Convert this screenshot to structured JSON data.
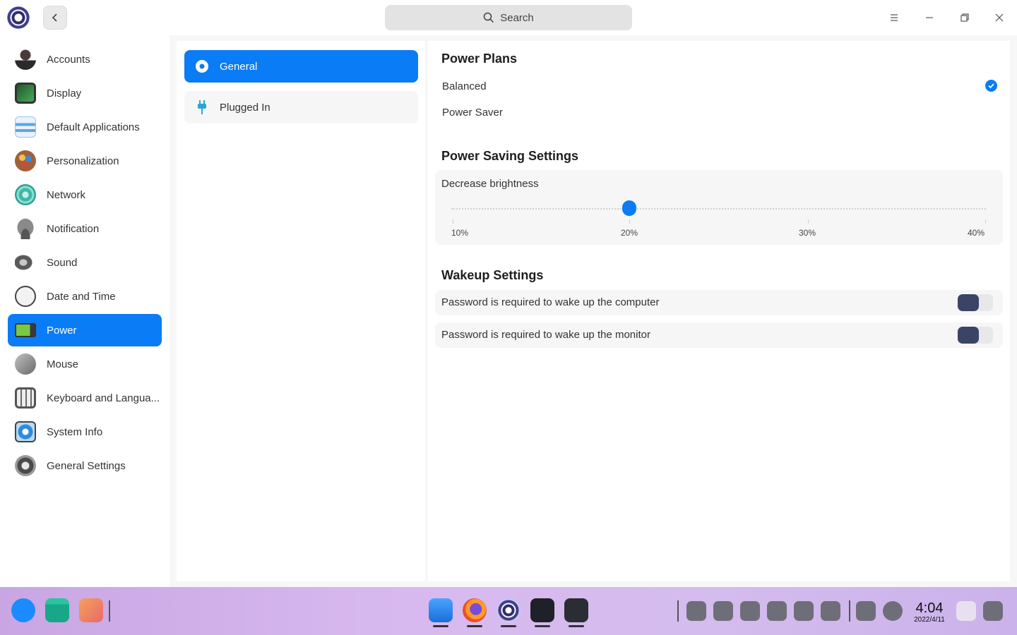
{
  "titlebar": {
    "search_placeholder": "Search"
  },
  "sidebar": {
    "items": [
      {
        "label": "Accounts",
        "icon": "accounts-icon",
        "color": "#2b2b2b"
      },
      {
        "label": "Display",
        "icon": "display-icon",
        "color": "#2f7a3f"
      },
      {
        "label": "Default Applications",
        "icon": "default-applications-icon",
        "color": "#5ea4e6"
      },
      {
        "label": "Personalization",
        "icon": "personalization-icon",
        "color": "#b0503a"
      },
      {
        "label": "Network",
        "icon": "network-icon",
        "color": "#3fb7a8"
      },
      {
        "label": "Notification",
        "icon": "notification-icon",
        "color": "#7d7d7d"
      },
      {
        "label": "Sound",
        "icon": "sound-icon",
        "color": "#5a5a5a"
      },
      {
        "label": "Date and Time",
        "icon": "clock-icon",
        "color": "#e8e8e8"
      },
      {
        "label": "Power",
        "icon": "battery-icon",
        "color": "#7ac943"
      },
      {
        "label": "Mouse",
        "icon": "mouse-icon",
        "color": "#8a8a8a"
      },
      {
        "label": "Keyboard and Langua...",
        "icon": "keyboard-icon",
        "color": "#6a6a6a"
      },
      {
        "label": "System Info",
        "icon": "system-info-icon",
        "color": "#2d8be0"
      },
      {
        "label": "General Settings",
        "icon": "general-settings-icon",
        "color": "#4a4a4a"
      }
    ],
    "active_index": 8
  },
  "middle": {
    "items": [
      {
        "label": "General",
        "icon": "gear-icon"
      },
      {
        "label": "Plugged In",
        "icon": "plug-icon"
      }
    ],
    "active_index": 0
  },
  "power_plans": {
    "title": "Power Plans",
    "options": [
      "Balanced",
      "Power Saver"
    ],
    "selected": "Balanced"
  },
  "power_saving": {
    "title": "Power Saving Settings",
    "brightness_label": "Decrease brightness",
    "ticks": [
      "10%",
      "20%",
      "30%",
      "40%"
    ],
    "value": "20%"
  },
  "wakeup": {
    "title": "Wakeup Settings",
    "computer_label": "Password is required to wake up the computer",
    "computer_enabled": false,
    "monitor_label": "Password is required to wake up the monitor",
    "monitor_enabled": false
  },
  "taskbar": {
    "time": "4:04",
    "date": "2022/4/11"
  },
  "colors": {
    "accent": "#0a7cf5",
    "toggle_knob": "#3a4565"
  }
}
